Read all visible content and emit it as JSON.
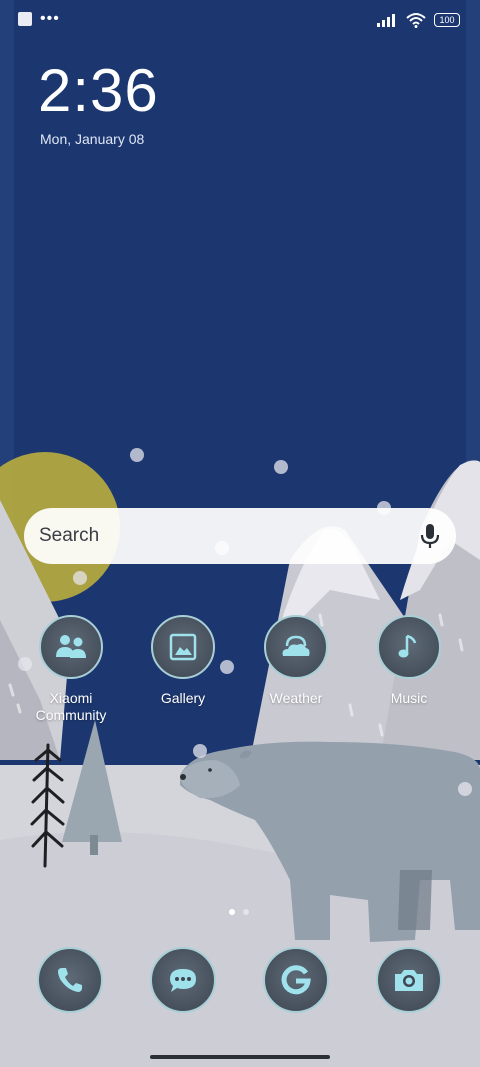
{
  "status": {
    "battery": "100",
    "icons": [
      "notification-square-icon",
      "more-dots-icon",
      "signal-icon",
      "wifi-icon",
      "battery-icon"
    ]
  },
  "lockscreen": {
    "time": "2:36",
    "date": "Mon, January 08"
  },
  "search": {
    "placeholder": "Search",
    "icon": "microphone-icon"
  },
  "apps": [
    {
      "label": "Xiaomi Community",
      "icon": "community-icon"
    },
    {
      "label": "Gallery",
      "icon": "gallery-icon"
    },
    {
      "label": "Weather",
      "icon": "weather-icon"
    },
    {
      "label": "Music",
      "icon": "music-icon"
    }
  ],
  "dock": [
    {
      "icon": "phone-icon"
    },
    {
      "icon": "messages-icon"
    },
    {
      "icon": "google-icon"
    },
    {
      "icon": "camera-icon"
    }
  ],
  "pager": {
    "pages": 2,
    "current": 1
  },
  "colors": {
    "sky": "#1c3770",
    "snow": "#d4d4db",
    "icon_accent": "#9fe2ec",
    "icon_ring": "#a8ced6"
  }
}
